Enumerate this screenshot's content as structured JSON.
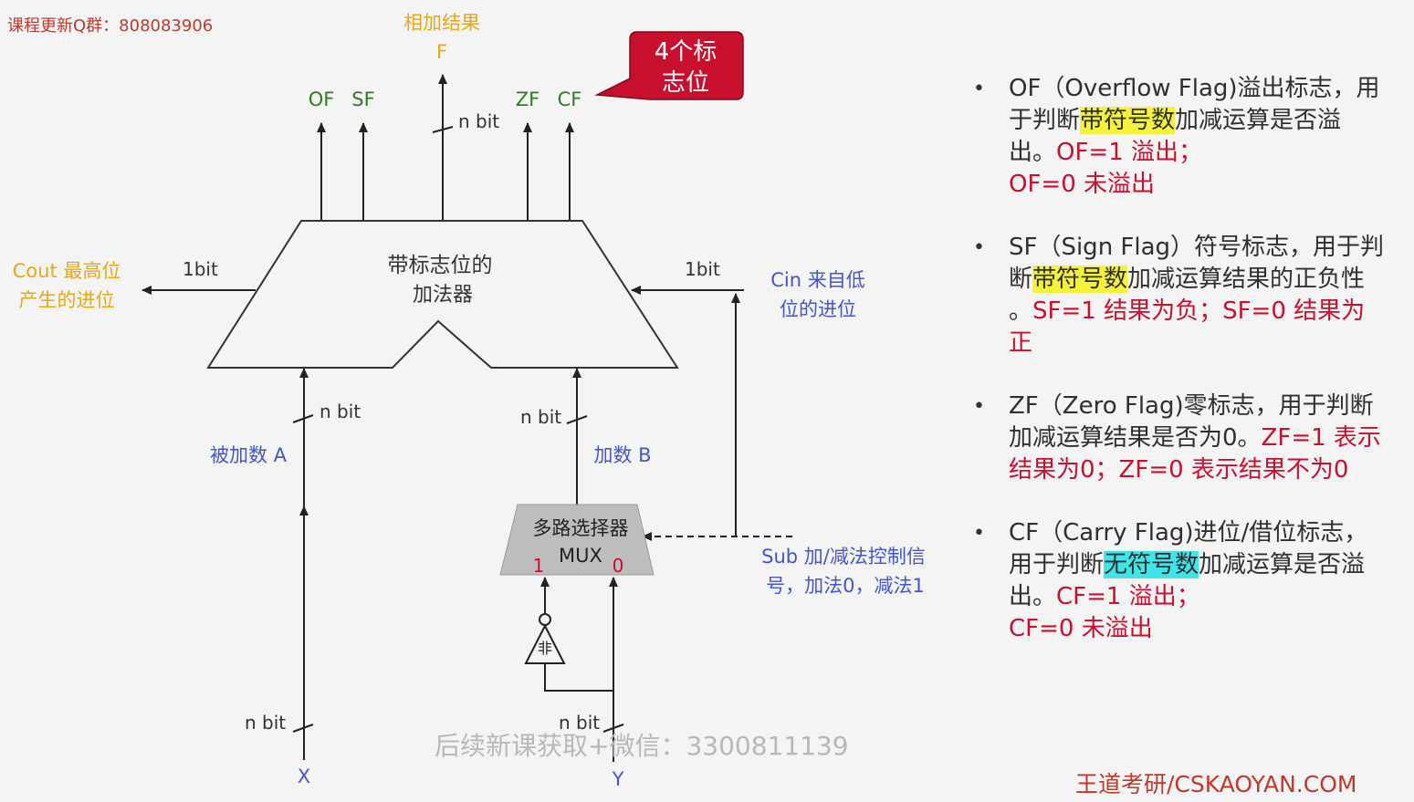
{
  "watermark_top": "课程更新Q群：808083906",
  "watermark_bottom": "后续新课获取+微信：3300811139",
  "brand": "王道考研/CSKAOYAN.COM",
  "callout": {
    "line1": "4个标",
    "line2": "志位"
  },
  "diagram": {
    "result_label": "相加结果",
    "result_var": "F",
    "flags": {
      "of": "OF",
      "sf": "SF",
      "zf": "ZF",
      "cf": "CF"
    },
    "adder_line1": "带标志位的",
    "adder_line2": "加法器",
    "cout_line1": "Cout 最高位",
    "cout_line2": "产生的进位",
    "cin_line1": "Cin 来自低",
    "cin_line2": "位的进位",
    "one_bit": "1bit",
    "n_bit": "n bit",
    "addend_a": "被加数 A",
    "addend_b": "加数 B",
    "mux_line1": "多路选择器",
    "mux_line2": "MUX",
    "mux_in1": "1",
    "mux_in0": "0",
    "not_gate": "非",
    "sub_line1": "Sub 加/减法控制信",
    "sub_line2": "号，加法0，减法1",
    "input_x": "X",
    "input_y": "Y"
  },
  "bullets": {
    "of": {
      "p1": "OF（Overflow Flag)溢出标志，用于判断",
      "hl": "带符号数",
      "p2": "加减运算是否溢出。",
      "r1": "OF=1 溢出；",
      "r2": "OF=0 未溢出"
    },
    "sf": {
      "p1": "SF（Sign Flag）符号标志，用于判断",
      "hl": "带符号数",
      "p2": "加减运算结果的正负性 。",
      "r1": "SF=1 结果为负；",
      "r2": "SF=0 结果为正"
    },
    "zf": {
      "p1": "ZF（Zero Flag)零标志，用于判断加减运算结果是否为0。",
      "r1": "ZF=1 表示结果为0；",
      "r2": "ZF=0 表示结果不为0"
    },
    "cf": {
      "p1": "CF（Carry Flag)进位/借位标志，用于判断",
      "hl": "无符号数",
      "p2": "加减运算是否溢出。",
      "r1": "CF=1 溢出；",
      "r2": "CF=0 未溢出"
    }
  },
  "colors": {
    "flag_green": "#2e7d1e",
    "label_orange": "#e6a817",
    "label_blue": "#4455cc",
    "accent_red": "#c8102e",
    "highlight_yellow": "#f4f23a",
    "highlight_cyan": "#3ee6ea"
  }
}
